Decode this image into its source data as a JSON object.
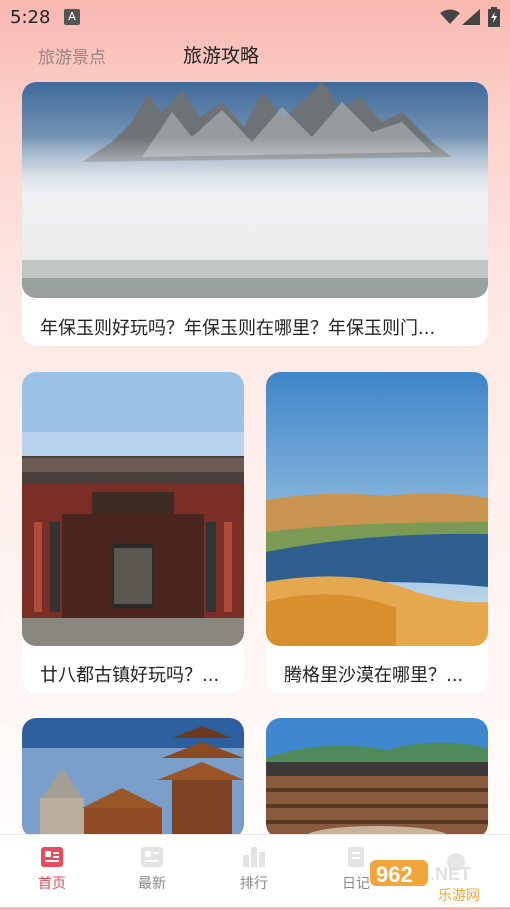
{
  "status": {
    "time": "5:28",
    "notif_letter": "A"
  },
  "tabs": [
    {
      "label": "旅游景点",
      "active": false
    },
    {
      "label": "旅游攻略",
      "active": true
    }
  ],
  "cards": [
    {
      "title": "年保玉则好玩吗？年保玉则在哪里？年保玉则门...",
      "image": "misty-mountain-lake-image"
    },
    {
      "title": "廿八都古镇好玩吗？...",
      "image": "ancient-town-gate-image"
    },
    {
      "title": "腾格里沙漠在哪里？...",
      "image": "desert-lake-image"
    },
    {
      "title": "",
      "image": "pagoda-temple-image"
    },
    {
      "title": "",
      "image": "tulou-earth-building-image"
    }
  ],
  "nav": [
    {
      "label": "首页",
      "icon": "home-icon",
      "active": true
    },
    {
      "label": "最新",
      "icon": "news-icon",
      "active": false
    },
    {
      "label": "排行",
      "icon": "rank-icon",
      "active": false
    },
    {
      "label": "日记",
      "icon": "diary-icon",
      "active": false
    }
  ],
  "watermark": {
    "brand": "962",
    "tld": ".NET",
    "site": "乐游网"
  },
  "colors": {
    "accent": "#e84b5a",
    "inactive": "#888888"
  }
}
